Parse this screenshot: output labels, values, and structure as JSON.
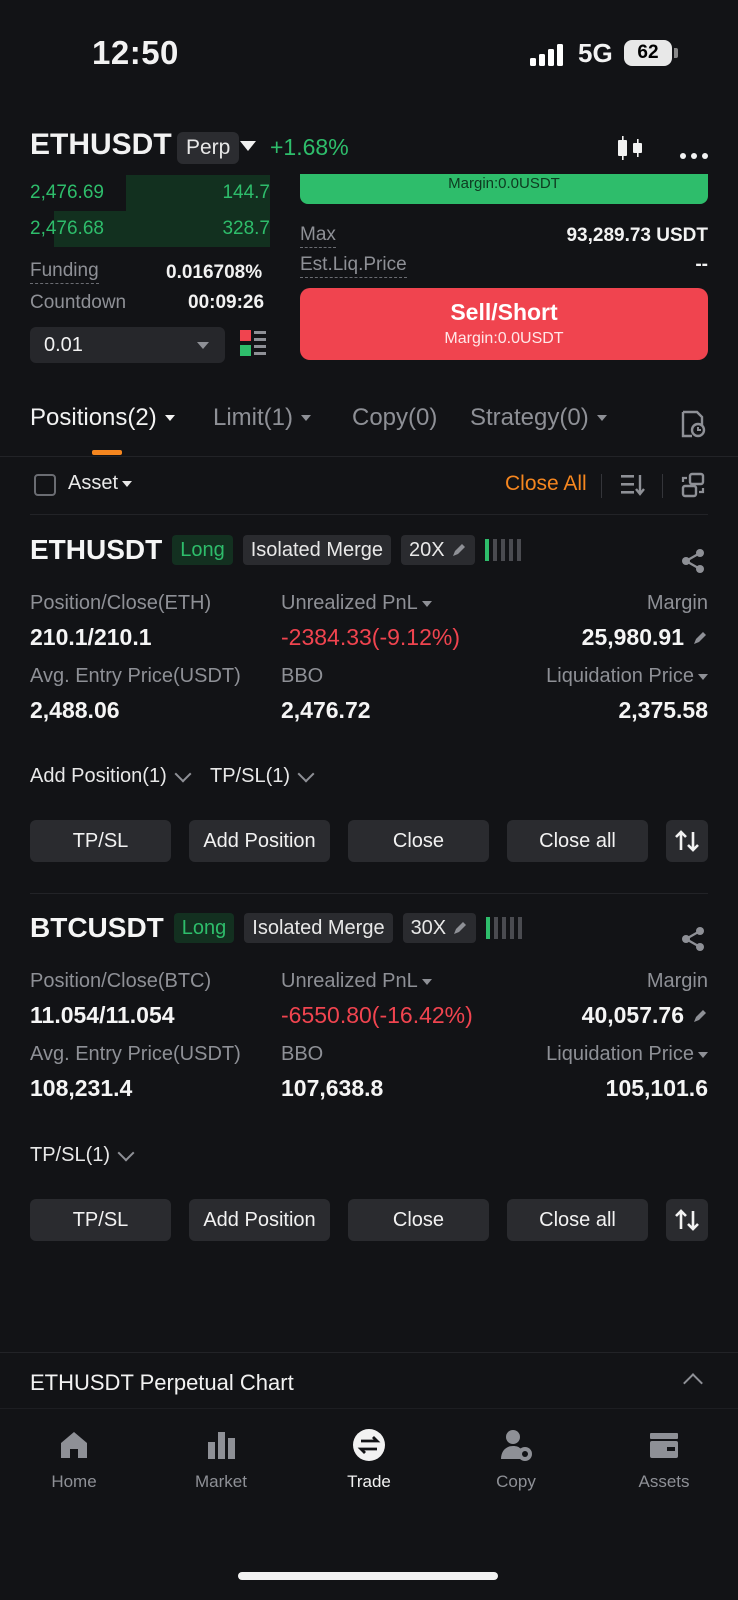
{
  "status_bar": {
    "time": "12:50",
    "network": "5G",
    "battery": "62"
  },
  "header": {
    "symbol": "ETHUSDT",
    "contract_type": "Perp",
    "change": "+1.68%"
  },
  "order_book": {
    "rows": [
      {
        "price": "2,476.69",
        "qty": "144.7",
        "depth": 0.6
      },
      {
        "price": "2,476.68",
        "qty": "328.7",
        "depth": 0.9
      }
    ],
    "funding_label": "Funding",
    "funding_value": "0.016708%",
    "countdown_label": "Countdown",
    "countdown_value": "00:09:26",
    "quantity_value": "0.01"
  },
  "order_panel": {
    "buy_margin": "Margin:0.0USDT",
    "max_label": "Max",
    "max_value": "93,289.73 USDT",
    "liq_label": "Est.Liq.Price",
    "liq_value": "--",
    "sell_label": "Sell/Short",
    "sell_margin": "Margin:0.0USDT"
  },
  "tabs": [
    {
      "label": "Positions(2)"
    },
    {
      "label": "Limit(1)"
    },
    {
      "label": "Copy(0)"
    },
    {
      "label": "Strategy(0)"
    }
  ],
  "filter": {
    "asset_label": "Asset",
    "close_all": "Close All"
  },
  "positions": [
    {
      "symbol": "ETHUSDT",
      "side": "Long",
      "mode": "Isolated Merge",
      "leverage": "20X",
      "pos_label": "Position/Close(ETH)",
      "pos_value": "210.1/210.1",
      "pnl_label": "Unrealized PnL",
      "pnl_value": "-2384.33(-9.12%)",
      "margin_label": "Margin",
      "margin_value": "25,980.91",
      "entry_label": "Avg. Entry Price(USDT)",
      "entry_value": "2,488.06",
      "bbo_label": "BBO",
      "bbo_value": "2,476.72",
      "liq_label": "Liquidation Price",
      "liq_value": "2,375.58",
      "expander_1": "Add Position(1)",
      "expander_2": "TP/SL(1)",
      "btn_tpsl": "TP/SL",
      "btn_add": "Add Position",
      "btn_close": "Close",
      "btn_close_all": "Close all"
    },
    {
      "symbol": "BTCUSDT",
      "side": "Long",
      "mode": "Isolated Merge",
      "leverage": "30X",
      "pos_label": "Position/Close(BTC)",
      "pos_value": "11.054/11.054",
      "pnl_label": "Unrealized PnL",
      "pnl_value": "-6550.80(-16.42%)",
      "margin_label": "Margin",
      "margin_value": "40,057.76",
      "entry_label": "Avg. Entry Price(USDT)",
      "entry_value": "108,231.4",
      "bbo_label": "BBO",
      "bbo_value": "107,638.8",
      "liq_label": "Liquidation Price",
      "liq_value": "105,101.6",
      "expander_1": "TP/SL(1)",
      "btn_tpsl": "TP/SL",
      "btn_add": "Add Position",
      "btn_close": "Close",
      "btn_close_all": "Close all"
    }
  ],
  "chart_bar": {
    "label": "ETHUSDT Perpetual Chart"
  },
  "nav": [
    {
      "label": "Home",
      "icon": "home-icon"
    },
    {
      "label": "Market",
      "icon": "market-icon"
    },
    {
      "label": "Trade",
      "icon": "trade-icon"
    },
    {
      "label": "Copy",
      "icon": "copy-icon"
    },
    {
      "label": "Assets",
      "icon": "wallet-icon"
    }
  ],
  "colors": {
    "green": "#2ebd6b",
    "red": "#f0444f",
    "orange": "#f5861f",
    "background": "#121316"
  }
}
